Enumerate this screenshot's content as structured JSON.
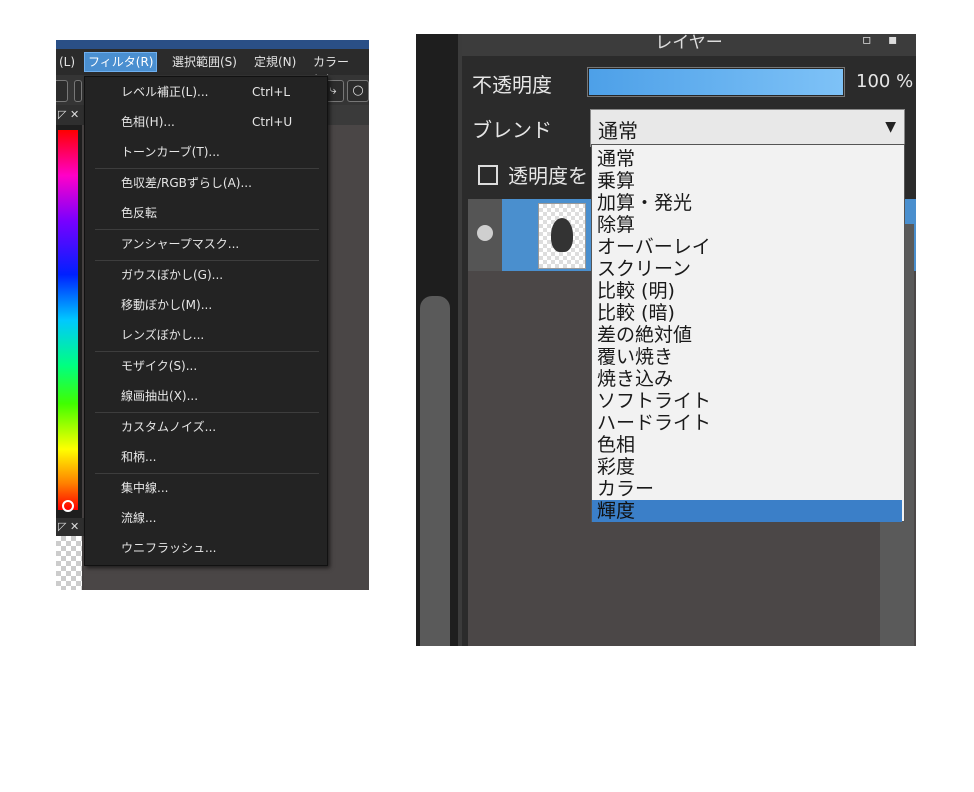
{
  "filter_window": {
    "menubar": [
      {
        "label": "(L)"
      },
      {
        "label": "フィルタ(R)",
        "active": true
      },
      {
        "label": "選択範囲(S)"
      },
      {
        "label": "定規(N)"
      },
      {
        "label": "カラー(C)"
      }
    ],
    "panel_icons": [
      "pin-icon",
      "close-icon"
    ],
    "filter_menu": {
      "items": [
        {
          "label": "レベル補正(L)...",
          "shortcut": "Ctrl+L"
        },
        {
          "label": "色相(H)...",
          "shortcut": "Ctrl+U"
        },
        {
          "label": "トーンカーブ(T)...",
          "shortcut": ""
        },
        {
          "label": "色収差/RGBずらし(A)...",
          "shortcut": ""
        },
        {
          "label": "色反転",
          "shortcut": ""
        },
        {
          "label": "アンシャープマスク...",
          "shortcut": ""
        },
        {
          "label": "ガウスぼかし(G)...",
          "shortcut": ""
        },
        {
          "label": "移動ぼかし(M)...",
          "shortcut": ""
        },
        {
          "label": "レンズぼかし...",
          "shortcut": ""
        },
        {
          "label": "モザイク(S)...",
          "shortcut": ""
        },
        {
          "label": "線画抽出(X)...",
          "shortcut": ""
        },
        {
          "label": "カスタムノイズ...",
          "shortcut": ""
        },
        {
          "label": "和柄...",
          "shortcut": ""
        },
        {
          "label": "集中線...",
          "shortcut": ""
        },
        {
          "label": "流線...",
          "shortcut": ""
        },
        {
          "label": "ウニフラッシュ...",
          "shortcut": ""
        }
      ]
    }
  },
  "layer_window": {
    "title": "レイヤー",
    "opacity": {
      "label": "不透明度",
      "value": 100,
      "value_text": "100 %"
    },
    "blend": {
      "label": "ブレンド",
      "current": "通常",
      "options": [
        "通常",
        "乗算",
        "加算・発光",
        "除算",
        "オーバーレイ",
        "スクリーン",
        "比較 (明)",
        "比較 (暗)",
        "差の絶対値",
        "覆い焼き",
        "焼き込み",
        "ソフトライト",
        "ハードライト",
        "色相",
        "彩度",
        "カラー",
        "輝度"
      ],
      "highlighted": "輝度"
    },
    "transparency_lock_label": "透明度を"
  },
  "colors": {
    "accent": "#4a8fd0",
    "menu_bg": "#232323",
    "dropdown_highlight": "#3b7fc8"
  }
}
